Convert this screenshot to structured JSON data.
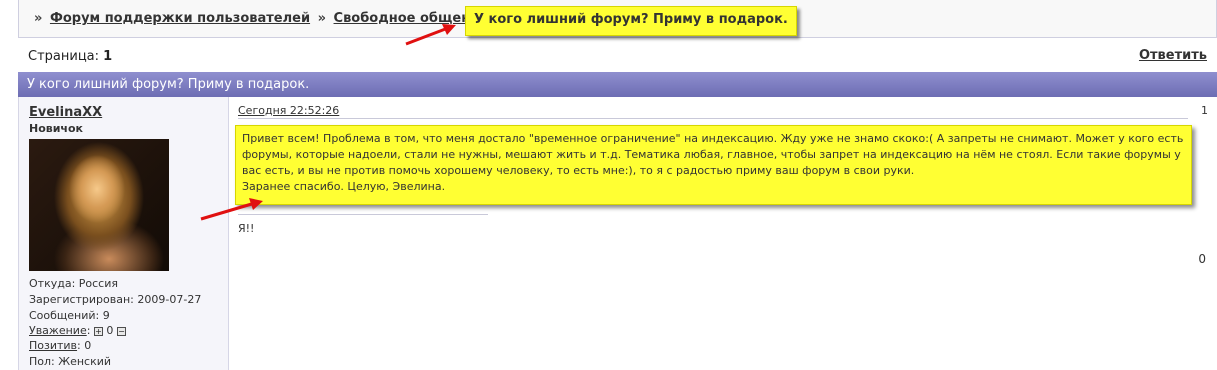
{
  "breadcrumb": {
    "separator": "»",
    "items": [
      "Форум поддержки пользователей",
      "Свободное общение"
    ],
    "current": "У кого лишний форум? Приму в подарок."
  },
  "pagination": {
    "label": "Страница:",
    "number": "1"
  },
  "reply_label": "Ответить",
  "topic_title": "У кого лишний форум? Приму в подарок.",
  "post": {
    "author": "EvelinaXX",
    "rank": "Новичок",
    "from": "Откуда: Россия",
    "registered": "Зарегистрирован: 2009-07-27",
    "messages": "Сообщений: 9",
    "respect_label": "Уважение",
    "respect_value": "0",
    "positive_label": "Позитив",
    "positive_value": "0",
    "gender": "Пол: Женский",
    "date": "Сегодня 22:52:26",
    "number": "1",
    "body_lines": [
      "Привет всем! Проблема в том, что меня достало \"временное ограничение\" на индексацию. Жду уже не знамо скоко:( А запреты не снимают. Может у кого есть",
      "форумы, которые надоели, стали не нужны, мешают жить и т.д. Тематика любая, главное, чтобы запрет на индексацию на нём не стоял. Если такие форумы у",
      "вас есть, и вы не против помочь хорошему человеку, то есть мне:), то я с радостью приму ваш форум в свои руки.",
      "Заранее спасибо. Целую, Эвелина."
    ],
    "signature": "Я!!",
    "side_count": "0"
  },
  "colors": {
    "highlight": "#ffff33",
    "arrow": "#e01010",
    "header": "#7575bb"
  }
}
